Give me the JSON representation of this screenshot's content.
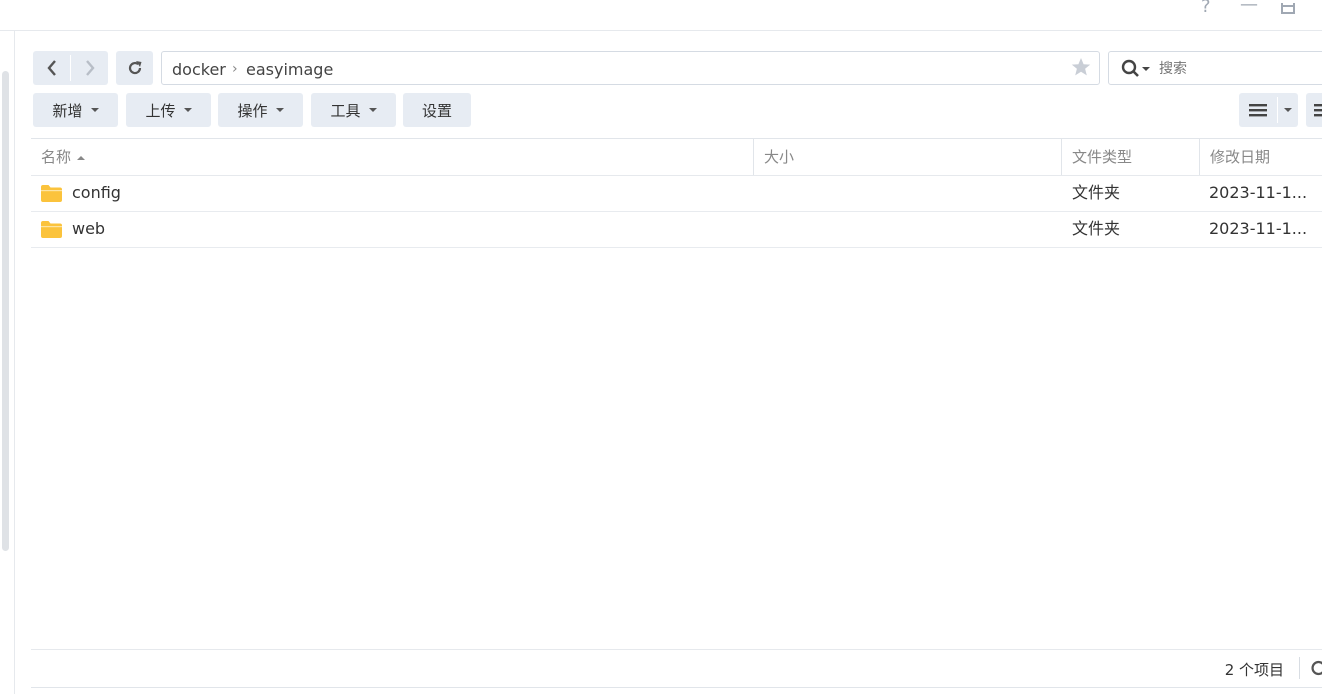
{
  "window": {
    "help_glyph": "?",
    "minimize_glyph": "—"
  },
  "nav": {
    "back_icon": "chevron-left",
    "forward_icon": "chevron-right",
    "refresh_icon": "refresh"
  },
  "path": {
    "segments": [
      "docker",
      "easyimage"
    ],
    "separator": "›",
    "favorite_icon": "star"
  },
  "search": {
    "placeholder": "搜索"
  },
  "toolbar": {
    "create_label": "新增",
    "upload_label": "上传",
    "action_label": "操作",
    "tools_label": "工具",
    "settings_label": "设置"
  },
  "table": {
    "columns": {
      "name": "名称",
      "size": "大小",
      "type": "文件类型",
      "modified": "修改日期"
    },
    "sort": {
      "column": "name",
      "direction": "ascending"
    },
    "rows": [
      {
        "name": "config",
        "size": "",
        "type": "文件夹",
        "modified": "2023-11-1..."
      },
      {
        "name": "web",
        "size": "",
        "type": "文件夹",
        "modified": "2023-11-1..."
      }
    ]
  },
  "status": {
    "item_count": "2 个项目"
  },
  "colors": {
    "button_bg": "#e7ecf3",
    "folder": "#fbc33c",
    "border": "#e1e5ea"
  }
}
